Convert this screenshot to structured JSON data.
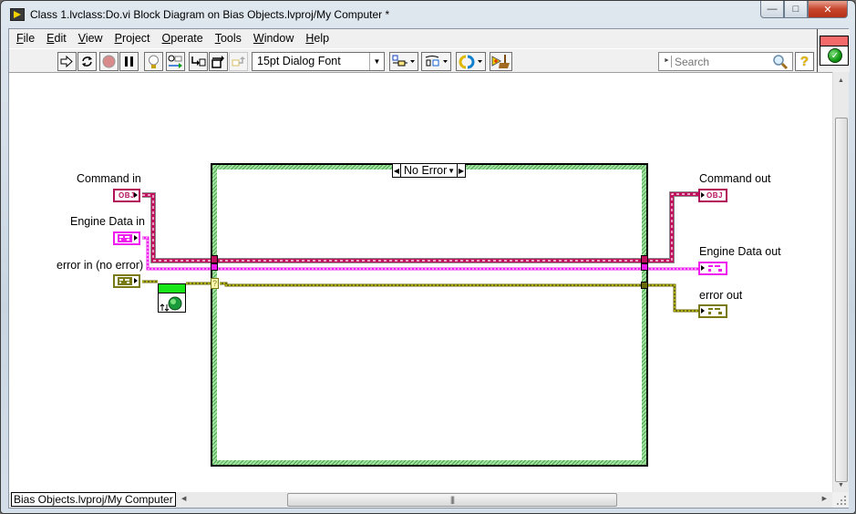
{
  "window": {
    "title": "Class 1.lvclass:Do.vi Block Diagram on Bias Objects.lvproj/My Computer *",
    "controls": {
      "minimize": "minimize",
      "maximize": "maximize",
      "close": "close"
    }
  },
  "menu": {
    "items": [
      {
        "label": "File",
        "mnemonic": "F"
      },
      {
        "label": "Edit",
        "mnemonic": "E"
      },
      {
        "label": "View",
        "mnemonic": "V"
      },
      {
        "label": "Project",
        "mnemonic": "P"
      },
      {
        "label": "Operate",
        "mnemonic": "O"
      },
      {
        "label": "Tools",
        "mnemonic": "T"
      },
      {
        "label": "Window",
        "mnemonic": "W"
      },
      {
        "label": "Help",
        "mnemonic": "H"
      }
    ]
  },
  "toolbar": {
    "buttons": [
      {
        "name": "run",
        "icon": "run-arrow-icon"
      },
      {
        "name": "run-continuously",
        "icon": "run-continuously-icon"
      },
      {
        "name": "abort",
        "icon": "abort-stop-icon"
      },
      {
        "name": "pause",
        "icon": "pause-icon"
      },
      {
        "name": "highlight-execution",
        "icon": "lightbulb-icon"
      },
      {
        "name": "retain-wire-values",
        "icon": "retain-wire-values-icon"
      },
      {
        "name": "step-into",
        "icon": "step-into-icon"
      },
      {
        "name": "step-over",
        "icon": "step-over-icon"
      },
      {
        "name": "step-out",
        "icon": "step-out-icon"
      },
      {
        "name": "align-objects",
        "icon": "align-objects-icon"
      },
      {
        "name": "distribute-objects",
        "icon": "distribute-objects-icon"
      },
      {
        "name": "reorder",
        "icon": "reorder-icon"
      },
      {
        "name": "clean-up-diagram",
        "icon": "clean-up-diagram-icon"
      }
    ],
    "font_select": "15pt Dialog Font",
    "search_placeholder": "Search",
    "help_label": "?"
  },
  "connector_pane": {
    "status": "ok",
    "top_color": "#f46a6a"
  },
  "diagram": {
    "inputs": [
      {
        "label": "Command in",
        "type": "object",
        "tag": "OBJ",
        "color": "#b4105a"
      },
      {
        "label": "Engine Data in",
        "type": "cluster",
        "color": "#ee1cee"
      },
      {
        "label": "error in (no error)",
        "type": "error cluster",
        "color": "#7a7a14"
      }
    ],
    "outputs": [
      {
        "label": "Command out",
        "type": "object",
        "tag": "OBJ",
        "color": "#b4105a"
      },
      {
        "label": "Engine Data out",
        "type": "cluster",
        "color": "#ee1cee"
      },
      {
        "label": "error out",
        "type": "error cluster",
        "color": "#7a7a14"
      }
    ],
    "case_structure": {
      "selector_value": "No Error",
      "decrement": "◀",
      "increment": "▶",
      "dropdown": "▼"
    },
    "case_selector_terminal": "?"
  },
  "status_bar": {
    "context": "Bias Objects.lvproj/My Computer",
    "scroll_thumb_grip": "|||"
  }
}
